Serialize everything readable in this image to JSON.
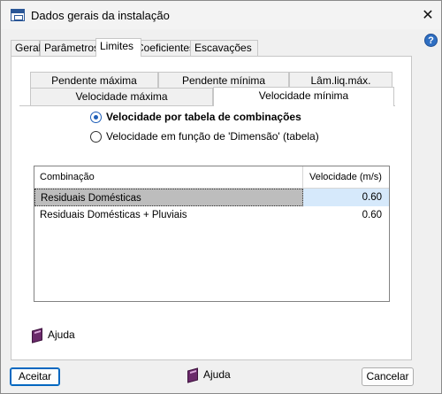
{
  "window": {
    "title": "Dados gerais da instalação",
    "close_glyph": "✕",
    "help_glyph": "?"
  },
  "main_tabs": [
    {
      "label": "Geral",
      "active": false
    },
    {
      "label": "Parâmetros",
      "active": false
    },
    {
      "label": "Limites",
      "active": true
    },
    {
      "label": "Coeficientes",
      "active": false
    },
    {
      "label": "Escavações",
      "active": false
    }
  ],
  "sub_tabs": {
    "row1": [
      {
        "label": "Pendente máxima"
      },
      {
        "label": "Pendente mínima"
      },
      {
        "label": "Lâm.liq.máx."
      }
    ],
    "row2": [
      {
        "label": "Velocidade máxima",
        "active": false
      },
      {
        "label": "Velocidade mínima",
        "active": true
      }
    ]
  },
  "options": [
    {
      "label": "Velocidade por tabela de combinações",
      "checked": true
    },
    {
      "label": "Velocidade em função de 'Dimensão' (tabela)",
      "checked": false
    }
  ],
  "table": {
    "columns": [
      "Combinação",
      "Velocidade (m/s)"
    ],
    "rows": [
      {
        "combination": "Residuais Domésticas",
        "velocity": "0.60",
        "selected": true
      },
      {
        "combination": "Residuais Domésticas + Pluviais",
        "velocity": "0.60",
        "selected": false
      }
    ]
  },
  "panel_help": "Ajuda",
  "footer": {
    "accept": "Aceitar",
    "help": "Ajuda",
    "cancel": "Cancelar"
  },
  "colors": {
    "accent": "#0067c0",
    "selection": "#d6e9fb",
    "selected_row": "#bdbdbd"
  }
}
